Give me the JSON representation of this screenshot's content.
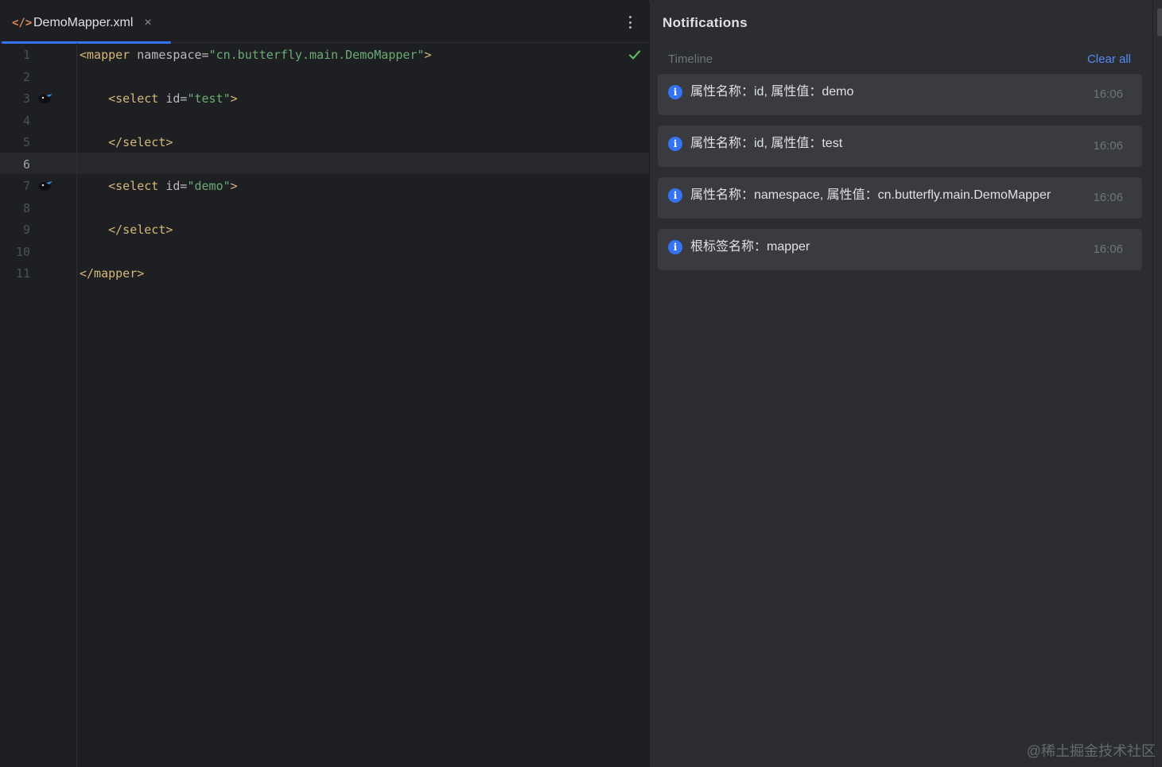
{
  "editor": {
    "tab": {
      "title": "DemoMapper.xml",
      "icon": "</>",
      "close": "×"
    },
    "lines": [
      {
        "num": "1",
        "tokens": [
          [
            "tag",
            "<mapper "
          ],
          [
            "attr",
            "namespace="
          ],
          [
            "val",
            "\"cn.butterfly.main.DemoMapper\""
          ],
          [
            "tag",
            ">"
          ]
        ]
      },
      {
        "num": "2",
        "tokens": []
      },
      {
        "num": "3",
        "gutter_icon": true,
        "tokens": [
          [
            "tag",
            "    <select "
          ],
          [
            "attr",
            "id="
          ],
          [
            "val",
            "\"test\""
          ],
          [
            "tag",
            ">"
          ]
        ]
      },
      {
        "num": "4",
        "tokens": []
      },
      {
        "num": "5",
        "tokens": [
          [
            "tag",
            "    </select>"
          ]
        ]
      },
      {
        "num": "6",
        "active": true,
        "tokens": []
      },
      {
        "num": "7",
        "gutter_icon": true,
        "tokens": [
          [
            "tag",
            "    <select "
          ],
          [
            "attr",
            "id="
          ],
          [
            "val",
            "\"demo\""
          ],
          [
            "tag",
            ">"
          ]
        ]
      },
      {
        "num": "8",
        "tokens": []
      },
      {
        "num": "9",
        "tokens": [
          [
            "tag",
            "    </select>"
          ]
        ]
      },
      {
        "num": "10",
        "tokens": []
      },
      {
        "num": "11",
        "tokens": [
          [
            "tag",
            "</mapper>"
          ]
        ]
      }
    ]
  },
  "notifications": {
    "title": "Notifications",
    "timeline_label": "Timeline",
    "clear_all": "Clear all",
    "items": [
      {
        "text": "属性名称：id, 属性值：demo",
        "time": "16:06"
      },
      {
        "text": "属性名称：id, 属性值：test",
        "time": "16:06"
      },
      {
        "text": "属性名称：namespace, 属性值：cn.butterfly.main.DemoMapper",
        "time": "16:06"
      },
      {
        "text": "根标签名称：mapper",
        "time": "16:06"
      }
    ]
  },
  "watermark": "@稀土掘金技术社区",
  "colors": {
    "accent": "#3574f0",
    "link": "#548af7",
    "tag": "#d5b778",
    "string": "#6aab73",
    "ok": "#5fb865"
  }
}
